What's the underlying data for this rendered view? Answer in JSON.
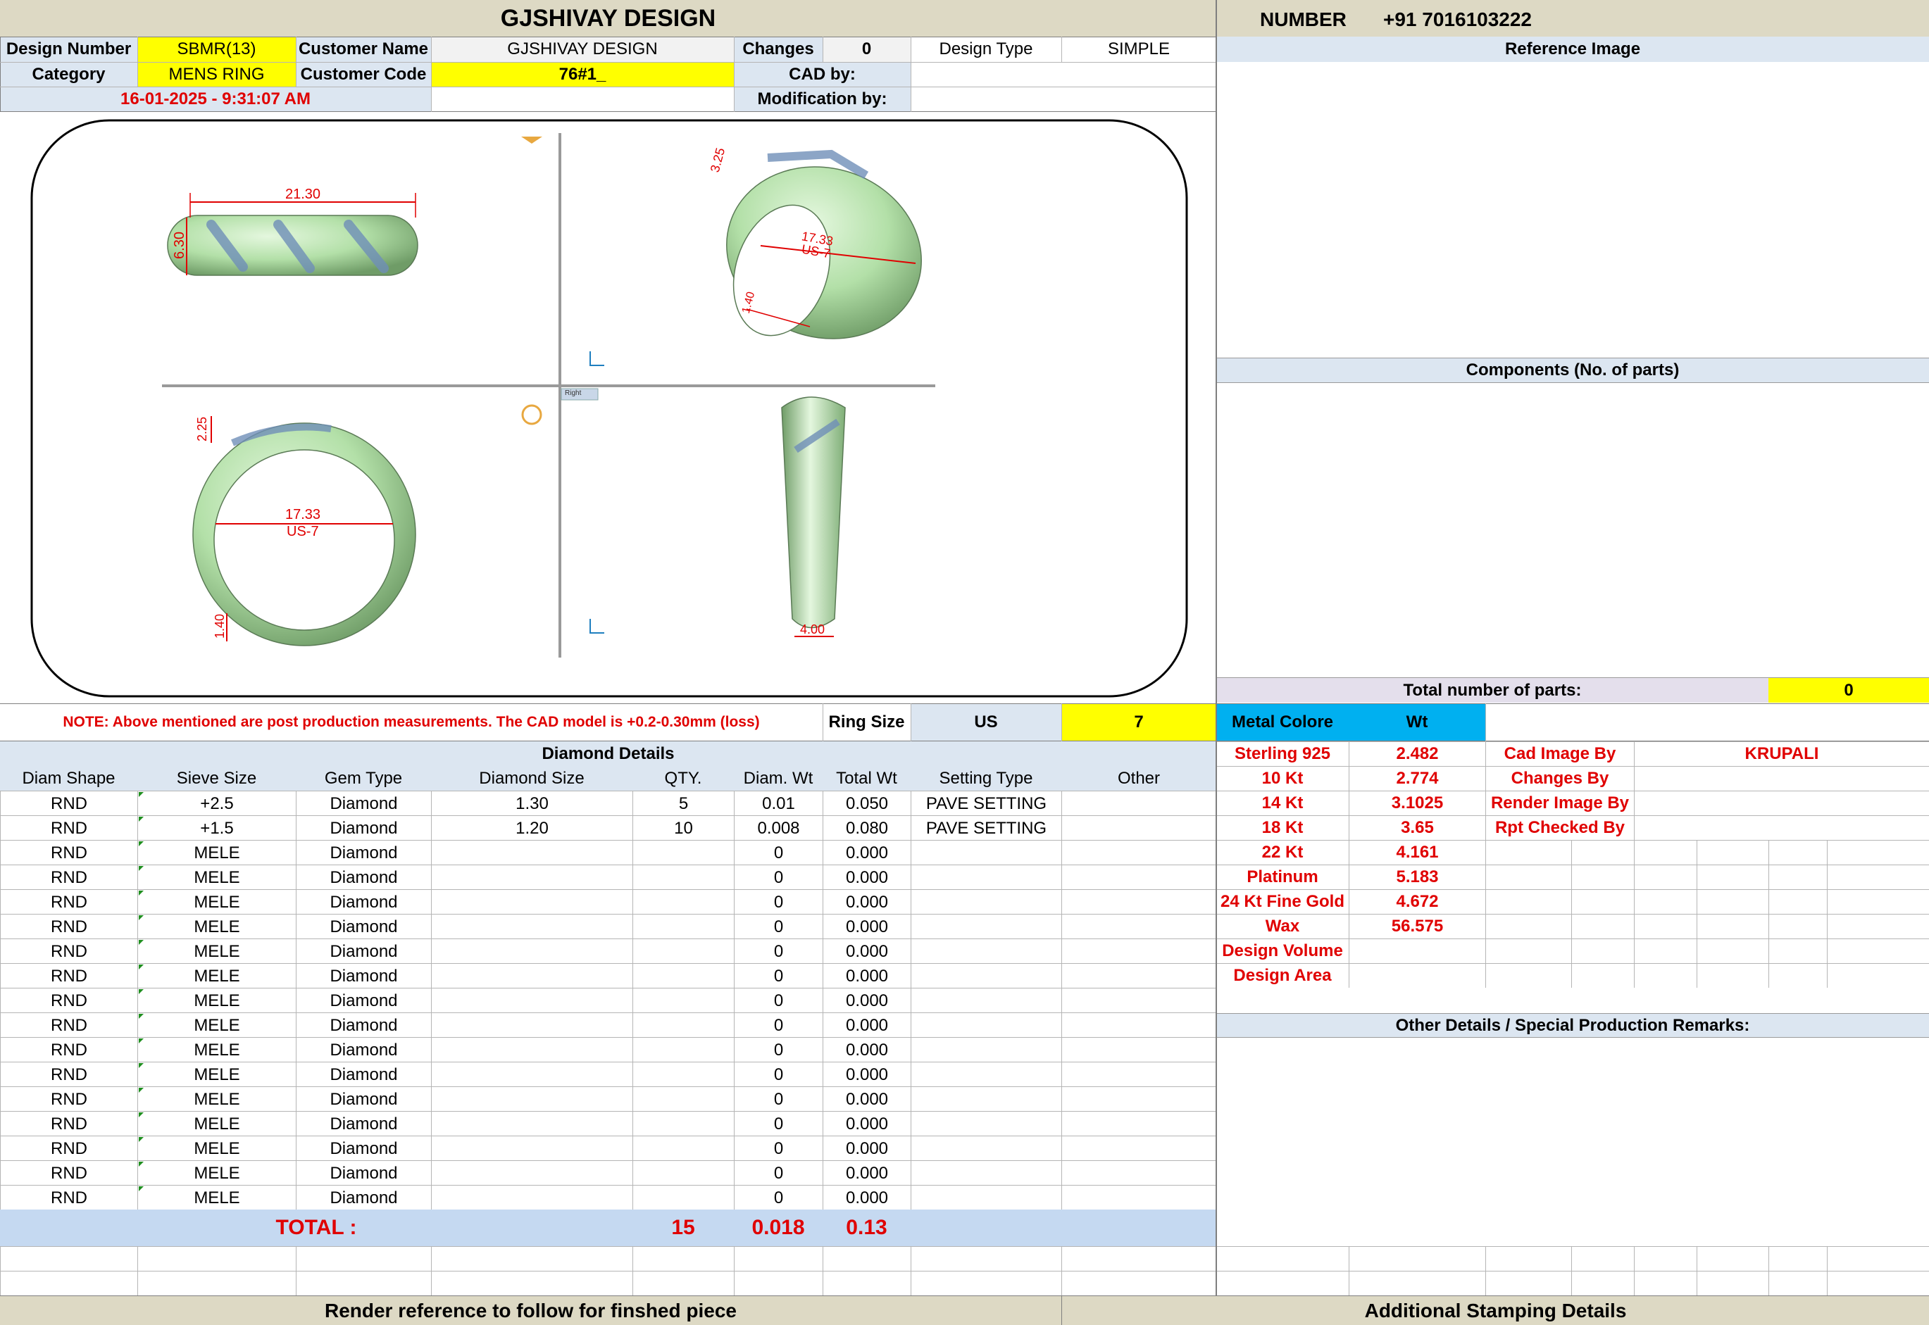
{
  "header": {
    "title": "GJSHIVAY DESIGN",
    "number_label": "NUMBER",
    "number_value": "+91 7016103222"
  },
  "info": {
    "design_number_label": "Design Number",
    "design_number": "SBMR(13)",
    "customer_name_label": "Customer Name",
    "customer_name": "GJSHIVAY DESIGN",
    "changes_label": "Changes",
    "changes": "0",
    "design_type_label": "Design Type",
    "design_type": "SIMPLE",
    "category_label": "Category",
    "category": "MENS RING",
    "customer_code_label": "Customer Code",
    "customer_code": "76#1_",
    "cad_by_label": "CAD by:",
    "datetime": "16-01-2025 - 9:31:07 AM",
    "modification_by_label": "Modification by:"
  },
  "drawing": {
    "top_width": "21.30",
    "top_height": "6.30",
    "persp_a": "3.25",
    "persp_size": "17.33",
    "persp_us": "US-7",
    "persp_b": "1.40",
    "front_top": "2.25",
    "front_size": "17.33",
    "front_us": "US-7",
    "front_bottom": "1.40",
    "side_width": "4.00",
    "viewport_label": "Right"
  },
  "right_panel": {
    "reference_image": "Reference Image",
    "components": "Components (No. of parts)",
    "total_parts_label": "Total number of parts:",
    "total_parts": "0",
    "metal_colore": "Metal Colore",
    "wt": "Wt",
    "other_details": "Other Details / Special Production Remarks:",
    "additional_stamping": "Additional Stamping Details"
  },
  "note": {
    "text": "NOTE: Above mentioned are post production measurements. The CAD model is +0.2-0.30mm (loss)",
    "ring_size_label": "Ring Size",
    "ring_size_unit": "US",
    "ring_size": "7"
  },
  "diamond": {
    "section_title": "Diamond Details",
    "columns": [
      "Diam Shape",
      "Sieve Size",
      "Gem Type",
      "Diamond Size",
      "QTY.",
      "Diam. Wt",
      "Total Wt",
      "Setting Type",
      "Other"
    ],
    "rows": [
      [
        "RND",
        "+2.5",
        "Diamond",
        "1.30",
        "5",
        "0.01",
        "0.050",
        "PAVE SETTING",
        ""
      ],
      [
        "RND",
        "+1.5",
        "Diamond",
        "1.20",
        "10",
        "0.008",
        "0.080",
        "PAVE SETTING",
        ""
      ],
      [
        "RND",
        "MELE",
        "Diamond",
        "",
        "",
        "0",
        "0.000",
        "",
        ""
      ],
      [
        "RND",
        "MELE",
        "Diamond",
        "",
        "",
        "0",
        "0.000",
        "",
        ""
      ],
      [
        "RND",
        "MELE",
        "Diamond",
        "",
        "",
        "0",
        "0.000",
        "",
        ""
      ],
      [
        "RND",
        "MELE",
        "Diamond",
        "",
        "",
        "0",
        "0.000",
        "",
        ""
      ],
      [
        "RND",
        "MELE",
        "Diamond",
        "",
        "",
        "0",
        "0.000",
        "",
        ""
      ],
      [
        "RND",
        "MELE",
        "Diamond",
        "",
        "",
        "0",
        "0.000",
        "",
        ""
      ],
      [
        "RND",
        "MELE",
        "Diamond",
        "",
        "",
        "0",
        "0.000",
        "",
        ""
      ],
      [
        "RND",
        "MELE",
        "Diamond",
        "",
        "",
        "0",
        "0.000",
        "",
        ""
      ],
      [
        "RND",
        "MELE",
        "Diamond",
        "",
        "",
        "0",
        "0.000",
        "",
        ""
      ],
      [
        "RND",
        "MELE",
        "Diamond",
        "",
        "",
        "0",
        "0.000",
        "",
        ""
      ],
      [
        "RND",
        "MELE",
        "Diamond",
        "",
        "",
        "0",
        "0.000",
        "",
        ""
      ],
      [
        "RND",
        "MELE",
        "Diamond",
        "",
        "",
        "0",
        "0.000",
        "",
        ""
      ],
      [
        "RND",
        "MELE",
        "Diamond",
        "",
        "",
        "0",
        "0.000",
        "",
        ""
      ],
      [
        "RND",
        "MELE",
        "Diamond",
        "",
        "",
        "0",
        "0.000",
        "",
        ""
      ],
      [
        "RND",
        "MELE",
        "Diamond",
        "",
        "",
        "0",
        "0.000",
        "",
        ""
      ]
    ],
    "total_label": "TOTAL :",
    "total_qty": "15",
    "total_diam_wt": "0.018",
    "total_wt": "0.13"
  },
  "metals": [
    {
      "name": "Sterling 925",
      "wt": "2.482"
    },
    {
      "name": "10 Kt",
      "wt": "2.774"
    },
    {
      "name": "14 Kt",
      "wt": "3.1025"
    },
    {
      "name": "18 Kt",
      "wt": "3.65"
    },
    {
      "name": "22 Kt",
      "wt": "4.161"
    },
    {
      "name": "Platinum",
      "wt": "5.183"
    },
    {
      "name": "24 Kt Fine Gold",
      "wt": "4.672"
    },
    {
      "name": "Wax",
      "wt": "56.575"
    },
    {
      "name": "Design Volume",
      "wt": ""
    },
    {
      "name": "Design Area",
      "wt": ""
    }
  ],
  "credits": [
    {
      "label": "Cad Image By",
      "value": "KRUPALI"
    },
    {
      "label": "Changes By",
      "value": ""
    },
    {
      "label": "Render Image By",
      "value": ""
    },
    {
      "label": "Rpt Checked By",
      "value": ""
    }
  ],
  "footer": {
    "render_reference": "Render reference to follow for finshed piece"
  },
  "colors": {
    "header_bg": "#ddd9c4",
    "label_bg": "#dce6f1",
    "highlight": "#ffff00",
    "metal_header": "#00b0f0",
    "total_bg": "#c5d9f1",
    "red_text": "#e00000",
    "ring_green": "#b9e3b0"
  }
}
